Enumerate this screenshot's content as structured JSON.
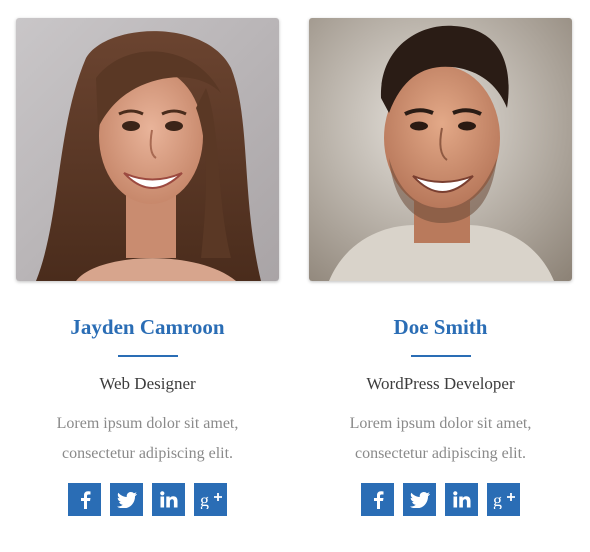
{
  "members": [
    {
      "name": "Jayden Camroon",
      "role": "Web Designer",
      "bio_line1": "Lorem ipsum dolor sit amet,",
      "bio_line2": "consectetur adipiscing elit.",
      "photo_alt": "Jayden Camroon",
      "socials": [
        "facebook-icon",
        "twitter-icon",
        "linkedin-icon",
        "google-plus-icon"
      ]
    },
    {
      "name": "Doe Smith",
      "role": "WordPress Developer",
      "bio_line1": "Lorem ipsum dolor sit amet,",
      "bio_line2": "consectetur adipiscing elit.",
      "photo_alt": "Doe Smith",
      "socials": [
        "facebook-icon",
        "twitter-icon",
        "linkedin-icon",
        "google-plus-icon"
      ]
    }
  ],
  "colors": {
    "accent": "#2a6db5",
    "name": "#2a6db5",
    "role": "#3d3d3d",
    "bio": "#8a8a8a",
    "social_icon": "#ffffff"
  }
}
